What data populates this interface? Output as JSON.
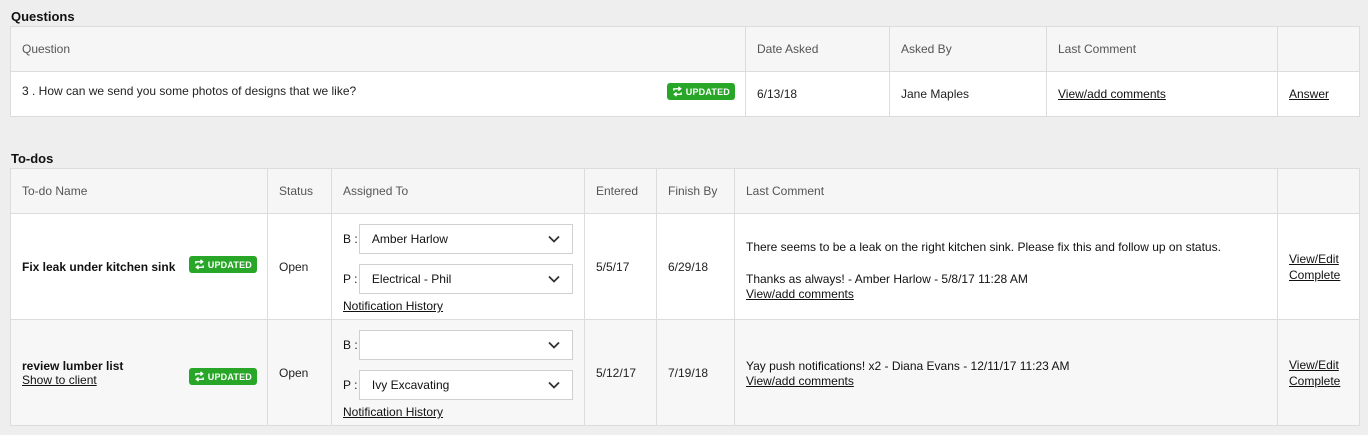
{
  "questions": {
    "title": "Questions",
    "headers": {
      "question": "Question",
      "date_asked": "Date Asked",
      "asked_by": "Asked By",
      "last_comment": "Last Comment"
    },
    "rows": [
      {
        "question": "3 . How can we send you some photos of designs that we like?",
        "badge": "UPDATED",
        "date_asked": "6/13/18",
        "asked_by": "Jane Maples",
        "last_comment_link": "View/add comments",
        "answer_link": "Answer"
      }
    ]
  },
  "todos": {
    "title": "To-dos",
    "headers": {
      "name": "To-do Name",
      "status": "Status",
      "assigned_to": "Assigned To",
      "entered": "Entered",
      "finish_by": "Finish By",
      "last_comment": "Last Comment"
    },
    "rows": [
      {
        "name": "Fix leak under kitchen sink",
        "badge": "UPDATED",
        "status": "Open",
        "b_label": "B :",
        "b_value": "Amber Harlow",
        "p_label": "P :",
        "p_value": "Electrical - Phil",
        "notification_link": "Notification History",
        "entered": "5/5/17",
        "finish_by": "6/29/18",
        "comment_line1": "There seems to be a leak on the right kitchen sink. Please fix this and follow up on status.",
        "comment_line2": "Thanks as always! - Amber Harlow - 5/8/17 11:28 AM",
        "comments_link": "View/add comments",
        "view_edit": "View/Edit",
        "complete": "Complete"
      },
      {
        "name": "review lumber list",
        "show_to_client": "Show to client",
        "badge": "UPDATED",
        "status": "Open",
        "b_label": "B :",
        "b_value": "",
        "p_label": "P :",
        "p_value": "Ivy Excavating",
        "notification_link": "Notification History",
        "entered": "5/12/17",
        "finish_by": "7/19/18",
        "comment_line1": "Yay push notifications! x2 - Diana Evans - 12/11/17 11:23 AM",
        "comments_link": "View/add comments",
        "view_edit": "View/Edit",
        "complete": "Complete"
      }
    ]
  },
  "colors": {
    "badge": "#27a627",
    "background": "#eeeeee",
    "border": "#dcdcdc"
  },
  "icons": {
    "badge_icon": "refresh-arrows-icon",
    "select_arrow": "chevron-down-icon"
  }
}
